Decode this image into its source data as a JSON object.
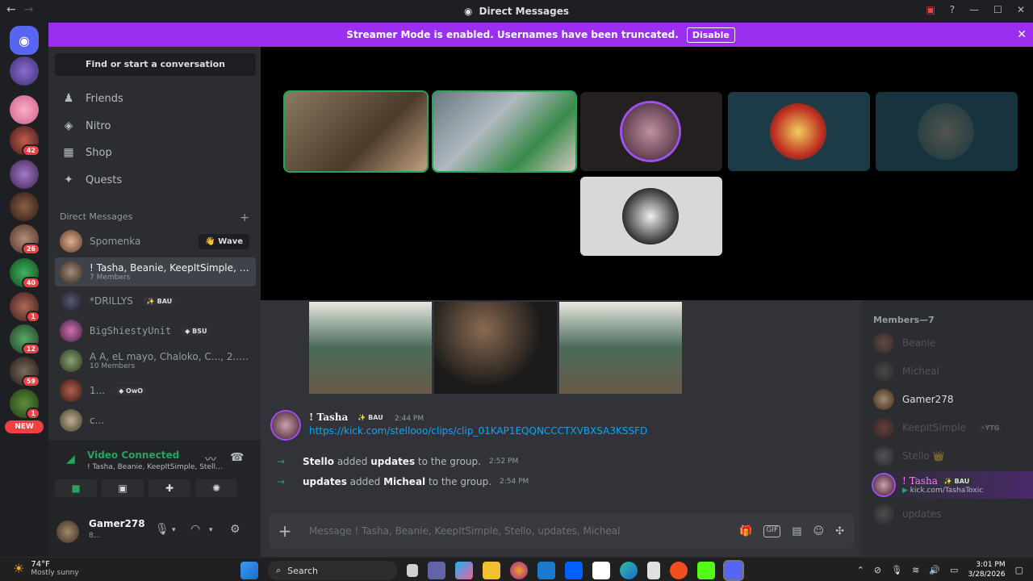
{
  "window": {
    "title": "Direct Messages"
  },
  "banner": {
    "text": "Streamer Mode is enabled. Usernames have been truncated.",
    "button": "Disable"
  },
  "rail": {
    "badges": [
      "42",
      "26",
      "40",
      "1",
      "12",
      "59",
      "1"
    ],
    "new_label": "NEW"
  },
  "sidebar": {
    "find": "Find or start a conversation",
    "nav": [
      {
        "label": "Friends",
        "icon": "friends-icon"
      },
      {
        "label": "Nitro",
        "icon": "nitro-icon"
      },
      {
        "label": "Shop",
        "icon": "shop-icon"
      },
      {
        "label": "Quests",
        "icon": "quests-icon"
      }
    ],
    "dm_header": "Direct Messages",
    "dms": [
      {
        "name": "Spomenka",
        "sub": "",
        "tag": "",
        "action": "👋 Wave"
      },
      {
        "name": "! Tasha, Beanie, KeepItSimple, St...",
        "sub": "7 Members",
        "tag": ""
      },
      {
        "name": "*DRILLYS",
        "sub": "",
        "tag": "✨ BAU"
      },
      {
        "name": "BigShiestyUnit",
        "sub": "",
        "tag": "◆ BSU"
      },
      {
        "name": "A A, eL mayo, Chaloko, C..., 2..., ...",
        "sub": "10 Members",
        "tag": ""
      },
      {
        "name": "1...",
        "sub": "",
        "tag": "◆ OwO"
      },
      {
        "name": "c...",
        "sub": "",
        "tag": ""
      }
    ]
  },
  "voice": {
    "status": "Video Connected",
    "channel": "! Tasha, Beanie, KeepItSimple, Stello, upd..."
  },
  "user": {
    "name": "Gamer278",
    "status": "8..."
  },
  "message": {
    "author": "! Tasha",
    "tag": "✨ BAU",
    "time": "2:44 PM",
    "link": "https://kick.com/stellooo/clips/clip_01KAP1EQQNCCCTXVBXSA3KSSFD"
  },
  "system": [
    {
      "actor": "Stello",
      "verb": "added",
      "target": "updates",
      "rest": "to the group.",
      "time": "2:52 PM"
    },
    {
      "actor": "updates",
      "verb": "added",
      "target": "Micheal",
      "rest": "to the group.",
      "time": "2:54 PM"
    }
  ],
  "composer": {
    "placeholder": "Message ! Tasha, Beanie, KeepItSimple, Stello, updates, Micheal"
  },
  "members": {
    "header": "Members—7",
    "list": [
      {
        "name": "Beanie",
        "dim": true
      },
      {
        "name": "Micheal",
        "dim": true
      },
      {
        "name": "Gamer278",
        "dim": false
      },
      {
        "name": "KeepItSimple",
        "tag": "⚡YTG",
        "dim": true
      },
      {
        "name": "Stello 👑",
        "dim": true
      },
      {
        "name": "! Tasha",
        "tag": "✨ BAU",
        "activity": "kick.com/TashaToxic",
        "dim": false
      },
      {
        "name": "updates",
        "dim": true
      }
    ]
  },
  "taskbar": {
    "weather_temp": "74°F",
    "weather_desc": "Mostly sunny",
    "search": "Search",
    "time": "3:01 PM",
    "date": "3/28/2026"
  }
}
